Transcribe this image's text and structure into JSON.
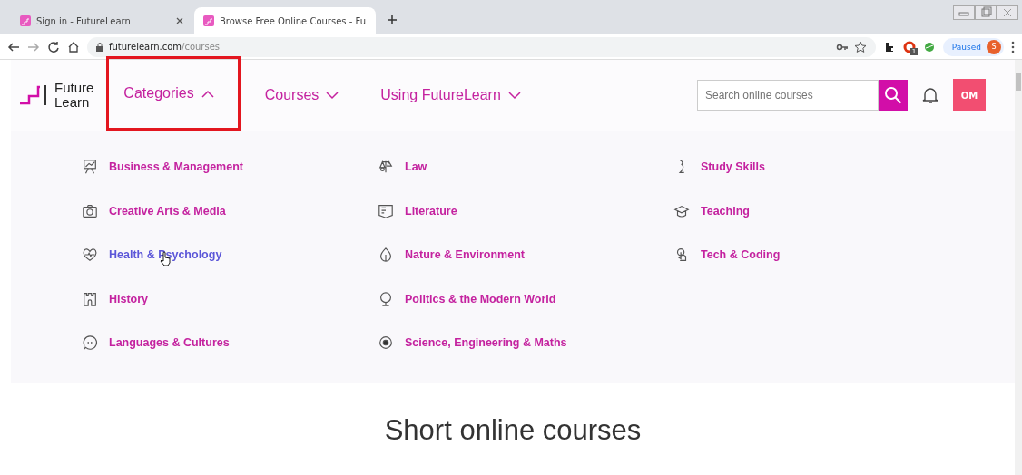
{
  "browser": {
    "tabs": [
      {
        "title": "Sign in - FutureLearn",
        "selected": false
      },
      {
        "title": "Browse Free Online Courses - Fu",
        "selected": true
      }
    ],
    "url_host": "futurelearn.com",
    "url_path": "/courses",
    "profile_status": "Paused",
    "profile_initial": "S",
    "extension_badge": "1"
  },
  "site": {
    "logo": [
      "Future",
      "Learn"
    ],
    "nav": [
      {
        "label": "Categories",
        "expanded": true,
        "highlighted": true
      },
      {
        "label": "Courses",
        "expanded": false,
        "highlighted": false
      },
      {
        "label": "Using FutureLearn",
        "expanded": false,
        "highlighted": false
      }
    ],
    "search": {
      "placeholder": "Search online courses"
    },
    "avatar": "OM"
  },
  "categories": [
    [
      {
        "label": "Business & Management",
        "hovered": false
      },
      {
        "label": "Creative Arts & Media",
        "hovered": false
      },
      {
        "label": "Health & Psychology",
        "hovered": true
      },
      {
        "label": "History",
        "hovered": false
      },
      {
        "label": "Languages & Cultures",
        "hovered": false
      }
    ],
    [
      {
        "label": "Law",
        "hovered": false
      },
      {
        "label": "Literature",
        "hovered": false
      },
      {
        "label": "Nature & Environment",
        "hovered": false
      },
      {
        "label": "Politics & the Modern World",
        "hovered": false
      },
      {
        "label": "Science, Engineering & Maths",
        "hovered": false
      }
    ],
    [
      {
        "label": "Study Skills",
        "hovered": false
      },
      {
        "label": "Teaching",
        "hovered": false
      },
      {
        "label": "Tech & Coding",
        "hovered": false
      }
    ]
  ],
  "heading": "Short online courses"
}
